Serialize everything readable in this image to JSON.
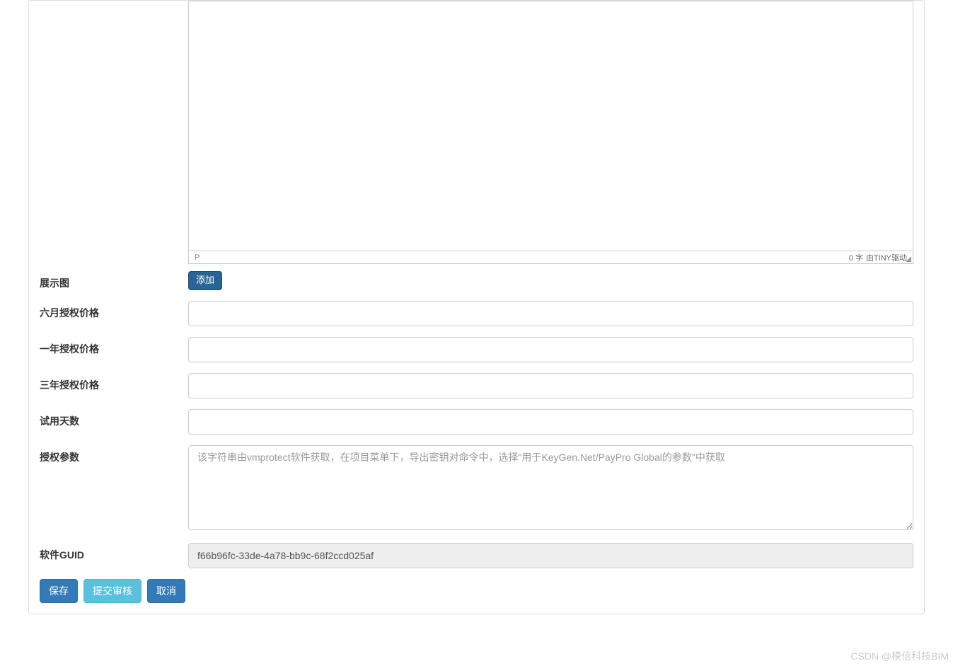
{
  "editor": {
    "status_path": "P",
    "word_count": "0 字",
    "powered_by": "由TINY驱动"
  },
  "fields": {
    "display_image": {
      "label": "展示图",
      "add_button": "添加"
    },
    "six_month_price": {
      "label": "六月授权价格",
      "value": ""
    },
    "one_year_price": {
      "label": "一年授权价格",
      "value": ""
    },
    "three_year_price": {
      "label": "三年授权价格",
      "value": ""
    },
    "trial_days": {
      "label": "试用天数",
      "value": ""
    },
    "auth_params": {
      "label": "授权参数",
      "placeholder": "该字符串由vmprotect软件获取，在项目菜单下，导出密钥对命令中，选择\"用于KeyGen.Net/PayPro Global的参数\"中获取",
      "value": ""
    },
    "software_guid": {
      "label": "软件GUID",
      "value": "f66b96fc-33de-4a78-bb9c-68f2ccd025af"
    }
  },
  "buttons": {
    "save": "保存",
    "submit_review": "提交审核",
    "cancel": "取消"
  },
  "watermark": "CSDN @模信科技BIM"
}
